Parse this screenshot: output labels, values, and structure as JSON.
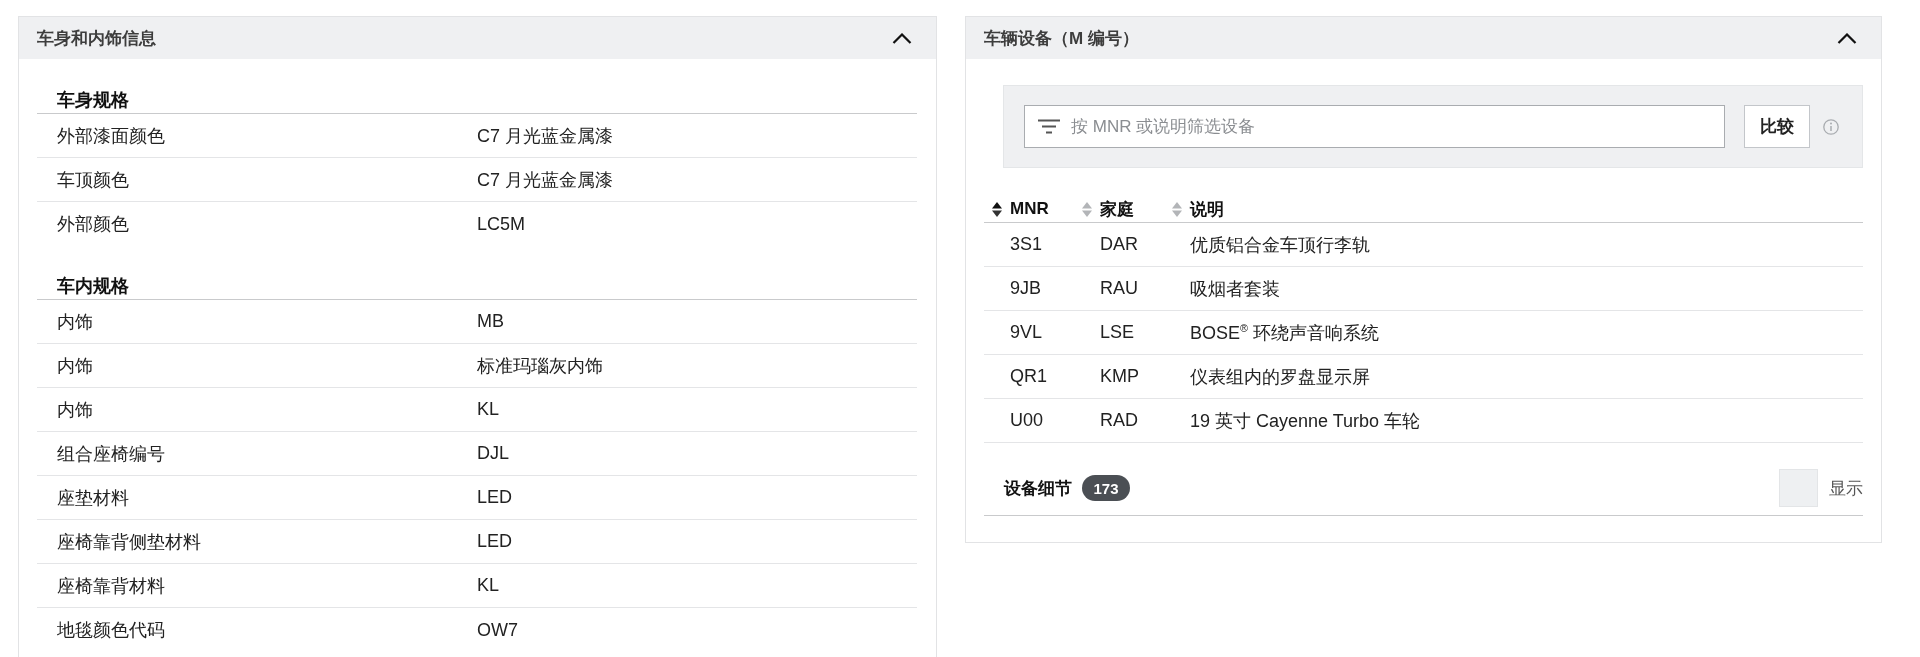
{
  "body_interior": {
    "title": "车身和内饰信息",
    "expanded": true,
    "sections": [
      {
        "heading": "车身规格",
        "rows": [
          {
            "label": "外部漆面颜色",
            "value": "C7 月光蓝金属漆"
          },
          {
            "label": "车顶颜色",
            "value": "C7 月光蓝金属漆"
          },
          {
            "label": "外部颜色",
            "value": "LC5M"
          }
        ]
      },
      {
        "heading": "车内规格",
        "rows": [
          {
            "label": "内饰",
            "value": "MB"
          },
          {
            "label": "内饰",
            "value": "标准玛瑙灰内饰"
          },
          {
            "label": "内饰",
            "value": "KL"
          },
          {
            "label": "组合座椅编号",
            "value": "DJL"
          },
          {
            "label": "座垫材料",
            "value": "LED"
          },
          {
            "label": "座椅靠背侧垫材料",
            "value": "LED"
          },
          {
            "label": "座椅靠背材料",
            "value": "KL"
          },
          {
            "label": "地毯颜色代码",
            "value": "OW7"
          }
        ]
      }
    ]
  },
  "equipment": {
    "title": "车辆设备（M 编号）",
    "expanded": true,
    "filter": {
      "placeholder": "按 MNR 或说明筛选设备"
    },
    "compare_button": "比较",
    "table": {
      "columns": [
        {
          "label": "MNR",
          "sorted": true
        },
        {
          "label": "家庭",
          "sorted": false
        },
        {
          "label": "说明",
          "sorted": false
        }
      ],
      "rows": [
        [
          "3S1",
          "DAR",
          "优质铝合金车顶行李轨"
        ],
        [
          "9JB",
          "RAU",
          "吸烟者套装"
        ],
        [
          "9VL",
          "LSE",
          "BOSE$^{®}$ 环绕声音响系统"
        ],
        [
          "QR1",
          "KMP",
          "仪表组内的罗盘显示屏"
        ],
        [
          "U00",
          "RAD",
          "19 英寸 Cayenne Turbo 车轮"
        ]
      ]
    },
    "details": {
      "label": "设备细节",
      "count": "173",
      "toggle": {
        "label": "显示",
        "checked": false
      }
    }
  }
}
